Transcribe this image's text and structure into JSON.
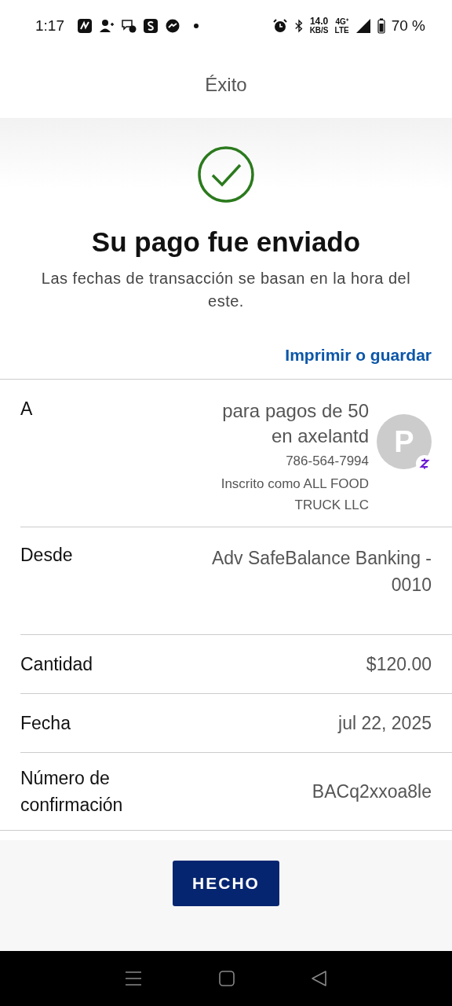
{
  "status_bar": {
    "time": "1:17",
    "speed": "14.0",
    "speed_unit": "KB/S",
    "network": "4G⁺",
    "network_sub": "LTE",
    "battery": "70 %"
  },
  "header": {
    "title": "Éxito"
  },
  "result": {
    "title": "Su pago fue enviado",
    "note": "Las fechas de transacción se basan en la hora del este.",
    "link": "Imprimir o guardar"
  },
  "recipient": {
    "label": "A",
    "name": "para pagos de 50 en axelantd",
    "phone": "786-564-7994",
    "enrolled": "Inscrito como ALL FOOD TRUCK LLC",
    "avatar": "P"
  },
  "details": [
    {
      "label": "Desde",
      "value": "Adv SafeBalance Banking - 0010"
    },
    {
      "label": "Cantidad",
      "value": "$120.00"
    },
    {
      "label": "Fecha",
      "value": "jul 22, 2025"
    },
    {
      "label": "Número de confirmación",
      "value": "BACq2xxoa8le"
    }
  ],
  "button": "HECHO"
}
